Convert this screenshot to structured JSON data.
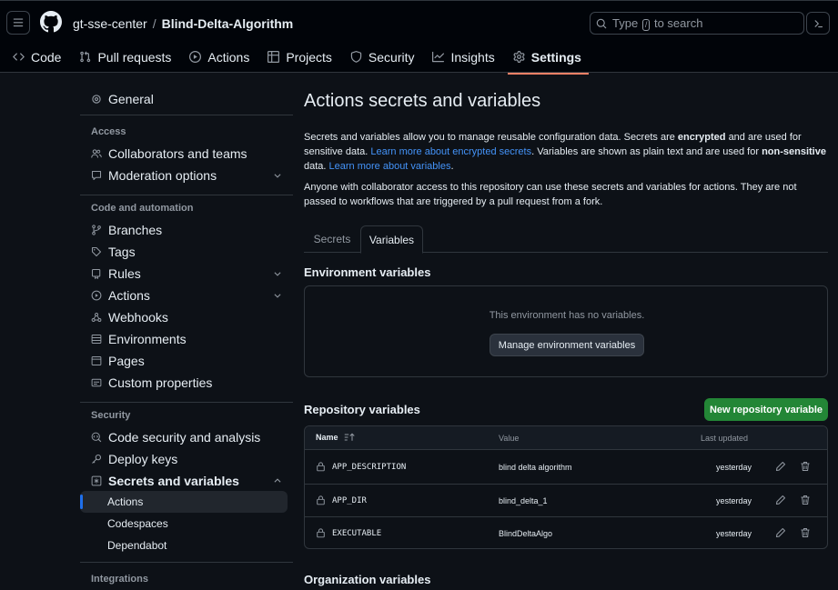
{
  "header": {
    "owner": "gt-sse-center",
    "separator": "/",
    "repo": "Blind-Delta-Algorithm",
    "search_prefix": "Type",
    "search_key": "/",
    "search_suffix": "to search"
  },
  "tabs": [
    {
      "label": "Code",
      "icon": "code-icon"
    },
    {
      "label": "Pull requests",
      "icon": "git-pull-request-icon"
    },
    {
      "label": "Actions",
      "icon": "play-icon"
    },
    {
      "label": "Projects",
      "icon": "table-icon"
    },
    {
      "label": "Security",
      "icon": "shield-icon"
    },
    {
      "label": "Insights",
      "icon": "graph-icon"
    },
    {
      "label": "Settings",
      "icon": "gear-icon",
      "active": true
    }
  ],
  "sidebar": {
    "general": "General",
    "access_heading": "Access",
    "collaborators": "Collaborators and teams",
    "moderation": "Moderation options",
    "code_heading": "Code and automation",
    "branches": "Branches",
    "tags": "Tags",
    "rules": "Rules",
    "actions": "Actions",
    "webhooks": "Webhooks",
    "environments": "Environments",
    "pages": "Pages",
    "custom_properties": "Custom properties",
    "security_heading": "Security",
    "code_security": "Code security and analysis",
    "deploy_keys": "Deploy keys",
    "secrets_vars": "Secrets and variables",
    "sub_actions": "Actions",
    "sub_codespaces": "Codespaces",
    "sub_dependabot": "Dependabot",
    "integrations_heading": "Integrations"
  },
  "main": {
    "title": "Actions secrets and variables",
    "intro_1": "Secrets and variables allow you to manage reusable configuration data. Secrets are",
    "intro_encrypted": "encrypted",
    "intro_2": "and are used for sensitive data.",
    "link_secrets": "Learn more about encrypted secrets",
    "intro_3": ". Variables are shown as plain text and are used for",
    "intro_nonsensitive": "non-sensitive",
    "intro_4": "data.",
    "link_variables": "Learn more about variables",
    "intro_5": ".",
    "access_note": "Anyone with collaborator access to this repository can use these secrets and variables for actions. They are not passed to workflows that are triggered by a pull request from a fork.",
    "subtab_secrets": "Secrets",
    "subtab_variables": "Variables",
    "env_heading": "Environment variables",
    "env_empty": "This environment has no variables.",
    "env_manage_button": "Manage environment variables",
    "repo_heading": "Repository variables",
    "new_repo_button": "New repository variable",
    "columns": {
      "name": "Name",
      "value": "Value",
      "last_updated": "Last updated"
    },
    "variables": [
      {
        "name": "APP_DESCRIPTION",
        "value": "blind delta algorithm",
        "updated": "yesterday"
      },
      {
        "name": "APP_DIR",
        "value": "blind_delta_1",
        "updated": "yesterday"
      },
      {
        "name": "EXECUTABLE",
        "value": "BlindDeltaAlgo",
        "updated": "yesterday"
      }
    ],
    "org_heading": "Organization variables"
  }
}
